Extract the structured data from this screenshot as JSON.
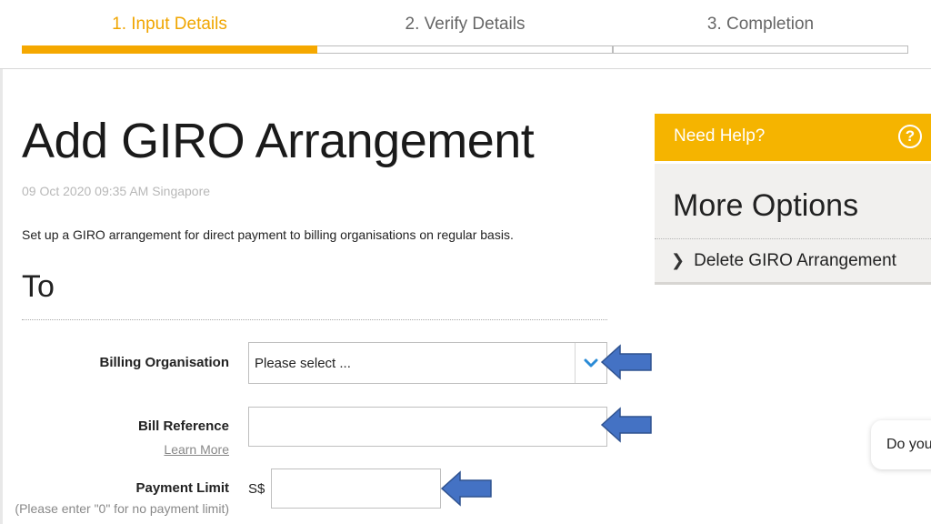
{
  "steps": [
    {
      "label": "1. Input Details",
      "active": true
    },
    {
      "label": "2. Verify Details",
      "active": false
    },
    {
      "label": "3. Completion",
      "active": false
    }
  ],
  "page": {
    "title": "Add GIRO Arrangement",
    "timestamp": "09 Oct 2020 09:35 AM Singapore",
    "intro": "Set up a GIRO arrangement for direct payment to billing organisations on regular basis.",
    "section_title": "To"
  },
  "form": {
    "billing_org_label": "Billing Organisation",
    "billing_org_value": "Please select ...",
    "bill_ref_label": "Bill Reference",
    "bill_ref_value": "",
    "learn_more": "Learn More",
    "payment_limit_label": "Payment Limit",
    "currency": "S$",
    "payment_limit_value": "",
    "payment_limit_hint": "(Please enter \"0\" for no payment limit)"
  },
  "sidebar": {
    "help_label": "Need Help?",
    "help_icon": "?",
    "options_title": "More Options",
    "options_link_caret": "❯",
    "options_link": "Delete GIRO Arrangement"
  },
  "chat": {
    "text": "Do you"
  },
  "colors": {
    "accent": "#f5a800",
    "arrow": "#4472c4",
    "chevron": "#2a8bd6"
  },
  "icons": [
    "help-icon",
    "chevron-down-icon",
    "arrow-left-icon",
    "caret-right-icon"
  ]
}
